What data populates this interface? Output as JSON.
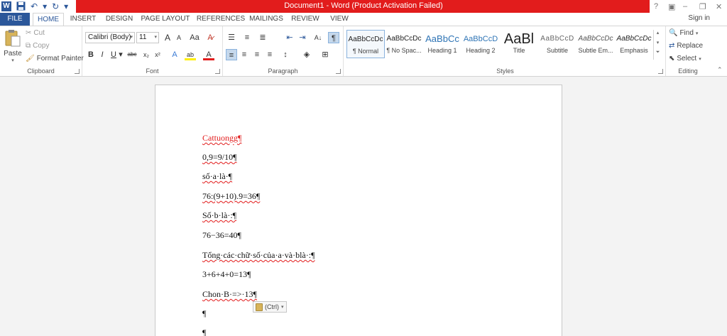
{
  "window": {
    "title": "Document1 - Word (Product Activation Failed)",
    "controls": {
      "help": "?",
      "minimize": "–",
      "restore": "❐",
      "close": "✕",
      "display_options": "▣"
    }
  },
  "qat": {
    "undo_icon": "↶",
    "redo_icon": "↻",
    "customize": "▾"
  },
  "tabs": {
    "file": "FILE",
    "home": "HOME",
    "insert": "INSERT",
    "design": "DESIGN",
    "page_layout": "PAGE LAYOUT",
    "references": "REFERENCES",
    "mailings": "MAILINGS",
    "review": "REVIEW",
    "view": "VIEW",
    "sign_in": "Sign in"
  },
  "clipboard": {
    "label": "Clipboard",
    "paste": "Paste",
    "cut": "Cut",
    "copy": "Copy",
    "format_painter": "Format Painter"
  },
  "font": {
    "label": "Font",
    "family": "Calibri (Body)",
    "size": "11",
    "grow": "A",
    "shrink": "A",
    "case": "Aa",
    "bold": "B",
    "italic": "I",
    "underline": "U",
    "strike": "abc",
    "subscript": "x₂",
    "superscript": "x²",
    "effects": "A",
    "highlight": "ab",
    "color": "A"
  },
  "paragraph": {
    "label": "Paragraph",
    "show_marks": "¶",
    "sort": "A↓"
  },
  "styles": {
    "label": "Styles",
    "items": [
      {
        "sample": "AaBbCcDc",
        "name": "¶ Normal"
      },
      {
        "sample": "AaBbCcDc",
        "name": "¶ No Spac..."
      },
      {
        "sample": "AaBbCc",
        "name": "Heading 1"
      },
      {
        "sample": "AaBbCcD",
        "name": "Heading 2"
      },
      {
        "sample": "AaBl",
        "name": "Title"
      },
      {
        "sample": "AaBbCcD",
        "name": "Subtitle"
      },
      {
        "sample": "AaBbCcDc",
        "name": "Subtle Em..."
      },
      {
        "sample": "AaBbCcDc",
        "name": "Emphasis"
      }
    ]
  },
  "editing": {
    "label": "Editing",
    "find": "Find",
    "replace": "Replace",
    "select": "Select"
  },
  "document": {
    "paragraphs": [
      {
        "text": "Cattuongg¶",
        "red": true,
        "squiggle": true
      },
      {
        "text": "0,9=9/10¶"
      },
      {
        "text": "số·a·là·¶"
      },
      {
        "text": "76:(9+10).9=36¶"
      },
      {
        "text": "Số·b·là·:¶"
      },
      {
        "text": "76−36=40¶"
      },
      {
        "text": "Tổng·các·chữ·số·của·a·và·blà·:¶"
      },
      {
        "text": "3+6+4+0=13¶"
      },
      {
        "text": "Chon·B·=>·13¶"
      },
      {
        "text": "¶"
      },
      {
        "text": "¶"
      }
    ],
    "paste_options": "(Ctrl)"
  }
}
